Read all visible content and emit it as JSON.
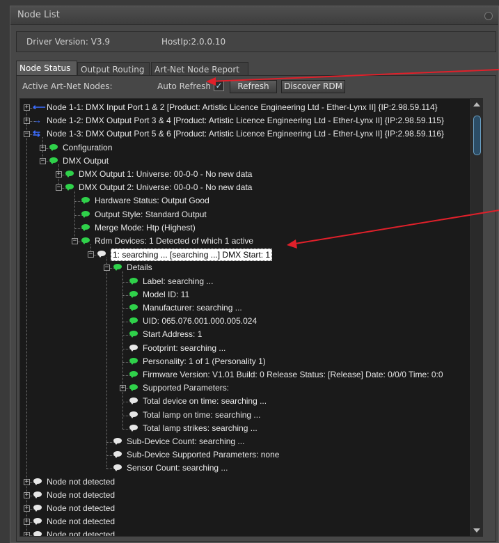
{
  "window": {
    "title": "Node List"
  },
  "info": {
    "driver_version": "Driver Version: V3.9",
    "host_ip": "HostIp:2.0.0.10"
  },
  "tabs": [
    {
      "label": "Node Status",
      "active": true
    },
    {
      "label": "Output Routing",
      "active": false
    },
    {
      "label": "Art-Net Node Report",
      "active": false
    }
  ],
  "toolbar": {
    "active_nodes_label": "Active Art-Net Nodes:",
    "auto_refresh_label": "Auto Refresh",
    "auto_refresh_checked": true,
    "refresh_label": "Refresh",
    "discover_label": "Discover RDM"
  },
  "tree": [
    {
      "text": "Node 1-1: DMX Input Port 1 & 2 [Product: Artistic Licence Engineering Ltd - Ether-Lynx II] {IP:2.98.59.114}",
      "icon": "arrow-left",
      "expander": "+"
    },
    {
      "text": "Node 1-2: DMX Output Port 3 & 4 [Product: Artistic Licence Engineering Ltd - Ether-Lynx II] {IP:2.98.59.115}",
      "icon": "arrow-right",
      "expander": "+"
    },
    {
      "text": "Node 1-3: DMX Output Port 5 & 6 [Product: Artistic Licence Engineering Ltd - Ether-Lynx II] {IP:2.98.59.116}",
      "icon": "arrow-right-double",
      "expander": "-"
    },
    {
      "text": "Configuration",
      "icon": "green",
      "expander": "+"
    },
    {
      "text": "DMX Output",
      "icon": "green",
      "expander": "-"
    },
    {
      "text": "DMX Output 1: Universe: 00-0-0  - No new data",
      "icon": "green",
      "expander": "+"
    },
    {
      "text": "DMX Output 2: Universe: 00-0-0  - No new data",
      "icon": "green",
      "expander": "-"
    },
    {
      "text": "Hardware Status: Output Good",
      "icon": "green",
      "expander": ""
    },
    {
      "text": "Output Style: Standard Output",
      "icon": "green",
      "expander": ""
    },
    {
      "text": "Merge Mode: Htp (Highest)",
      "icon": "green",
      "expander": ""
    },
    {
      "text": "Rdm Devices: 1 Detected of which 1 active",
      "icon": "green",
      "expander": "-"
    },
    {
      "text": "1: searching ... [searching ...] DMX Start: 1",
      "icon": "white",
      "expander": "-",
      "selected": true
    },
    {
      "text": "Details",
      "icon": "green",
      "expander": "-"
    },
    {
      "text": "Label: searching ...",
      "icon": "green",
      "expander": ""
    },
    {
      "text": "Model ID: 11",
      "icon": "green",
      "expander": ""
    },
    {
      "text": "Manufacturer: searching ...",
      "icon": "green",
      "expander": ""
    },
    {
      "text": "UID: 065.076.001.000.005.024",
      "icon": "green",
      "expander": ""
    },
    {
      "text": "Start Address: 1",
      "icon": "green",
      "expander": ""
    },
    {
      "text": "Footprint: searching ...",
      "icon": "white",
      "expander": ""
    },
    {
      "text": "Personality: 1 of 1 (Personality 1)",
      "icon": "green",
      "expander": ""
    },
    {
      "text": "Firmware Version: V1.01 Build: 0 Release Status: [Release] Date: 0/0/0 Time: 0:0",
      "icon": "green",
      "expander": ""
    },
    {
      "text": "Supported Parameters:",
      "icon": "green",
      "expander": "+"
    },
    {
      "text": "Total device on time: searching ...",
      "icon": "white",
      "expander": ""
    },
    {
      "text": "Total lamp on time: searching ...",
      "icon": "white",
      "expander": ""
    },
    {
      "text": "Total lamp strikes: searching ...",
      "icon": "white",
      "expander": ""
    },
    {
      "text": "Sub-Device Count: searching ...",
      "icon": "white",
      "expander": ""
    },
    {
      "text": "Sub-Device Supported Parameters: none",
      "icon": "white",
      "expander": ""
    },
    {
      "text": "Sensor Count: searching ...",
      "icon": "white",
      "expander": ""
    },
    {
      "text": "Node not detected",
      "icon": "white",
      "expander": "+"
    },
    {
      "text": "Node not detected",
      "icon": "white",
      "expander": "+"
    },
    {
      "text": "Node not detected",
      "icon": "white",
      "expander": "+"
    },
    {
      "text": "Node not detected",
      "icon": "white",
      "expander": "+"
    },
    {
      "text": "Node not detected",
      "icon": "white",
      "expander": "+"
    }
  ],
  "colors": {
    "annotation_arrow": "#e0202a",
    "selection_bg": "#ffffff",
    "bubble_green": "#2fd14a",
    "arrow_blue": "#3b6cff"
  }
}
